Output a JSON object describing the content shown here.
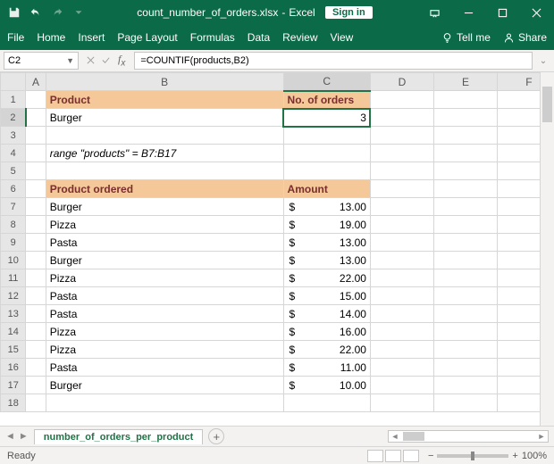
{
  "titlebar": {
    "filename": "count_number_of_orders.xlsx",
    "app": "Excel",
    "signin": "Sign in"
  },
  "ribbon": {
    "file": "File",
    "home": "Home",
    "insert": "Insert",
    "page_layout": "Page Layout",
    "formulas": "Formulas",
    "data": "Data",
    "review": "Review",
    "view": "View",
    "tell_me": "Tell me",
    "share": "Share"
  },
  "formula_bar": {
    "cell_ref": "C2",
    "formula": "=COUNTIF(products,B2)"
  },
  "columns": [
    "A",
    "B",
    "C",
    "D",
    "E",
    "F"
  ],
  "headers": {
    "product": "Product",
    "no_orders": "No. of orders",
    "product_ordered": "Product ordered",
    "amount": "Amount"
  },
  "summary": {
    "product": "Burger",
    "count": "3"
  },
  "note": "range \"products\" = B7:B17",
  "orders": [
    {
      "product": "Burger",
      "amount": "13.00"
    },
    {
      "product": "Pizza",
      "amount": "19.00"
    },
    {
      "product": "Pasta",
      "amount": "13.00"
    },
    {
      "product": "Burger",
      "amount": "13.00"
    },
    {
      "product": "Pizza",
      "amount": "22.00"
    },
    {
      "product": "Pasta",
      "amount": "15.00"
    },
    {
      "product": "Pasta",
      "amount": "14.00"
    },
    {
      "product": "Pizza",
      "amount": "16.00"
    },
    {
      "product": "Pizza",
      "amount": "22.00"
    },
    {
      "product": "Pasta",
      "amount": "11.00"
    },
    {
      "product": "Burger",
      "amount": "10.00"
    }
  ],
  "sheet_tab": "number_of_orders_per_product",
  "status": {
    "ready": "Ready",
    "zoom": "100%"
  }
}
